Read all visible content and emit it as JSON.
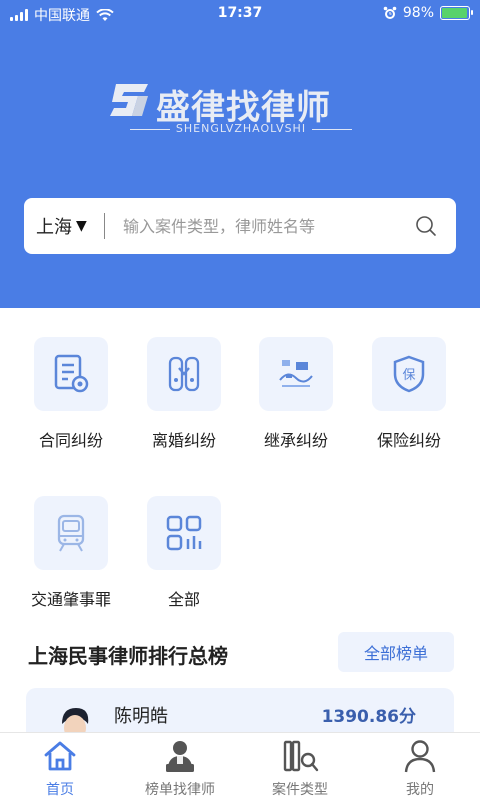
{
  "status": {
    "carrier": "中国联通",
    "time": "17:37",
    "battery": "98%",
    "battery_level": 0.98
  },
  "brand": {
    "name": "盛律找律师",
    "subtitle": "SHENGLVZHAOLVSHI"
  },
  "search": {
    "city": "上海",
    "caret": "▼",
    "placeholder": "输入案件类型，律师姓名等",
    "icon": "search-icon"
  },
  "categories": [
    {
      "label": "合同纠纷",
      "icon": "contract-icon"
    },
    {
      "label": "离婚纠纷",
      "icon": "divorce-icon"
    },
    {
      "label": "继承纠纷",
      "icon": "inheritance-icon"
    },
    {
      "label": "保险纠纷",
      "icon": "insurance-icon"
    },
    {
      "label": "交通肇事罪",
      "icon": "train-icon"
    },
    {
      "label": "全部",
      "icon": "grid-icon"
    }
  ],
  "ranking": {
    "title": "上海民事律师排行总榜",
    "all_button": "全部榜单",
    "lawyer": {
      "name": "陈明皓",
      "score": "1390.86分"
    }
  },
  "tabs": [
    {
      "label": "首页",
      "icon": "home-icon",
      "active": true
    },
    {
      "label": "榜单找律师",
      "icon": "lawyer-icon",
      "active": false
    },
    {
      "label": "案件类型",
      "icon": "case-type-icon",
      "active": false
    },
    {
      "label": "我的",
      "icon": "profile-icon",
      "active": false
    }
  ],
  "colors": {
    "brand": "#4a7de5",
    "tile_bg": "#eef3fd",
    "score": "#3a5fad"
  }
}
